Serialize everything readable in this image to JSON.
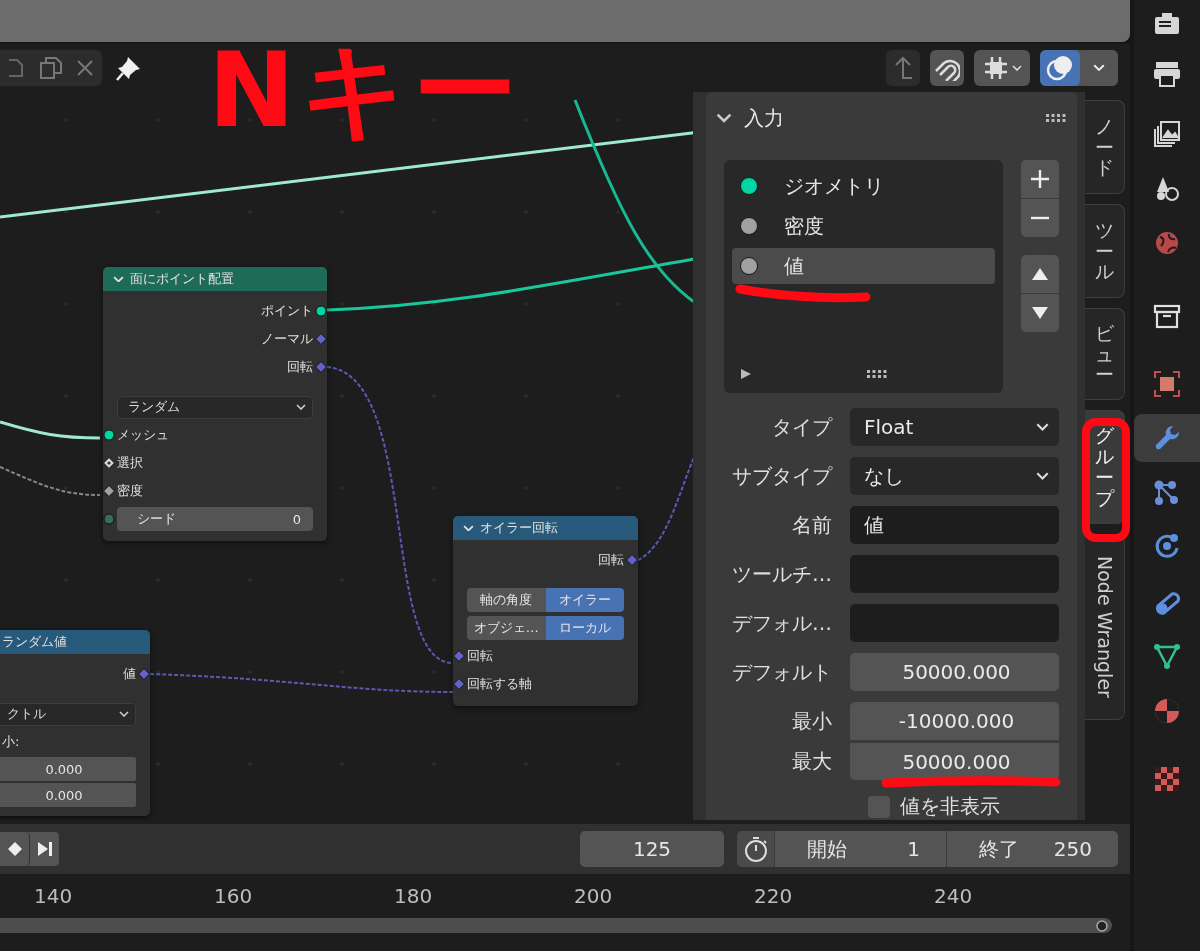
{
  "annotation": {
    "text": "Nキー"
  },
  "header": {
    "overlays_on": true
  },
  "nodes": [
    {
      "title": "面にポイント配置",
      "kind": "geometry",
      "show_arrow": true,
      "rows": [
        {
          "kind": "output",
          "label": "ポイント",
          "socket": {
            "kind": "geometry"
          }
        },
        {
          "kind": "output",
          "label": "ノーマル",
          "socket": {
            "kind": "vector"
          }
        },
        {
          "kind": "output",
          "label": "回転",
          "socket": {
            "kind": "vector"
          }
        },
        {
          "kind": "dropdown",
          "value": "ランダム"
        },
        {
          "kind": "input",
          "label": "メッシュ",
          "socket": {
            "kind": "geometry"
          }
        },
        {
          "kind": "input",
          "label": "選択",
          "socket": {
            "kind": "boolean"
          }
        },
        {
          "kind": "input",
          "label": "密度",
          "socket": {
            "kind": "float"
          }
        },
        {
          "kind": "number",
          "label": "シード",
          "value": "0",
          "socket": {
            "kind": "integer"
          }
        }
      ]
    },
    {
      "title": "オイラー回転",
      "kind": "utility",
      "show_arrow": true,
      "rows": [
        {
          "kind": "output",
          "label": "回転",
          "socket": {
            "kind": "vector"
          }
        },
        {
          "kind": "toggle",
          "options": [
            {
              "label": "軸の角度",
              "selected": false
            },
            {
              "label": "オイラー",
              "selected": true
            }
          ]
        },
        {
          "kind": "toggle",
          "options": [
            {
              "label": "オブジェ…",
              "selected": false
            },
            {
              "label": "ローカル",
              "selected": true
            }
          ]
        },
        {
          "kind": "input",
          "label": "回転",
          "socket": {
            "kind": "vector"
          }
        },
        {
          "kind": "input",
          "label": "回転する軸",
          "socket": {
            "kind": "vector"
          }
        }
      ]
    },
    {
      "title": "ランダム値",
      "kind": "utility",
      "show_arrow": false,
      "rows": [
        {
          "kind": "output",
          "label": "値",
          "socket": {
            "kind": "vector"
          }
        },
        {
          "kind": "dropdown",
          "value": "クトル"
        },
        {
          "kind": "label",
          "label": "小:"
        },
        {
          "kind": "value",
          "value": "0.000"
        },
        {
          "kind": "value",
          "value": "0.000"
        }
      ]
    }
  ],
  "n_panel": {
    "title": "入力",
    "sockets": [
      {
        "label": "ジオメトリ",
        "kind": "geometry",
        "selected": false
      },
      {
        "label": "密度",
        "kind": "float",
        "selected": false
      },
      {
        "label": "値",
        "kind": "float",
        "selected": true
      }
    ],
    "properties": [
      {
        "kind": "dropdown",
        "label": "タイプ",
        "value": "Float"
      },
      {
        "kind": "dropdown",
        "label": "サブタイプ",
        "value": "なし"
      },
      {
        "kind": "text",
        "label": "名前",
        "value": "値"
      },
      {
        "kind": "text",
        "label": "ツールチ…"
      },
      {
        "kind": "text",
        "label": "デフォル…"
      },
      {
        "kind": "number",
        "label": "デフォルト",
        "value": "50000.000"
      },
      {
        "kind": "number",
        "label": "最小",
        "value": "-10000.000"
      },
      {
        "kind": "number",
        "label": "最大",
        "value": "50000.000",
        "joined": true
      }
    ],
    "checkbox": {
      "label": "値を非表示",
      "checked": false
    }
  },
  "tabs": [
    {
      "label": "ノード",
      "kind": "stacked",
      "selected": false
    },
    {
      "label": "ツール",
      "kind": "stacked",
      "selected": false
    },
    {
      "label": "ビュー",
      "kind": "stacked",
      "selected": false
    },
    {
      "label": "グループ",
      "kind": "stacked",
      "selected": true
    },
    {
      "label": "Node Wrangler",
      "kind": "rotated",
      "selected": false
    }
  ],
  "properties_tabs": [
    {
      "selected": false
    },
    {
      "selected": false
    },
    {
      "selected": false
    },
    {
      "selected": false
    },
    {
      "selected": false
    },
    {
      "selected": false
    },
    {
      "selected": false
    },
    {
      "selected": true
    },
    {
      "selected": false
    },
    {
      "selected": false
    },
    {
      "selected": false
    },
    {
      "selected": false
    },
    {
      "selected": false
    },
    {
      "selected": false
    }
  ],
  "timeline": {
    "current_frame": "125",
    "start": {
      "label": "開始",
      "value": "1"
    },
    "end": {
      "label": "終了",
      "value": "250"
    },
    "ticks": [
      "140",
      "160",
      "180",
      "200",
      "220",
      "240"
    ]
  }
}
